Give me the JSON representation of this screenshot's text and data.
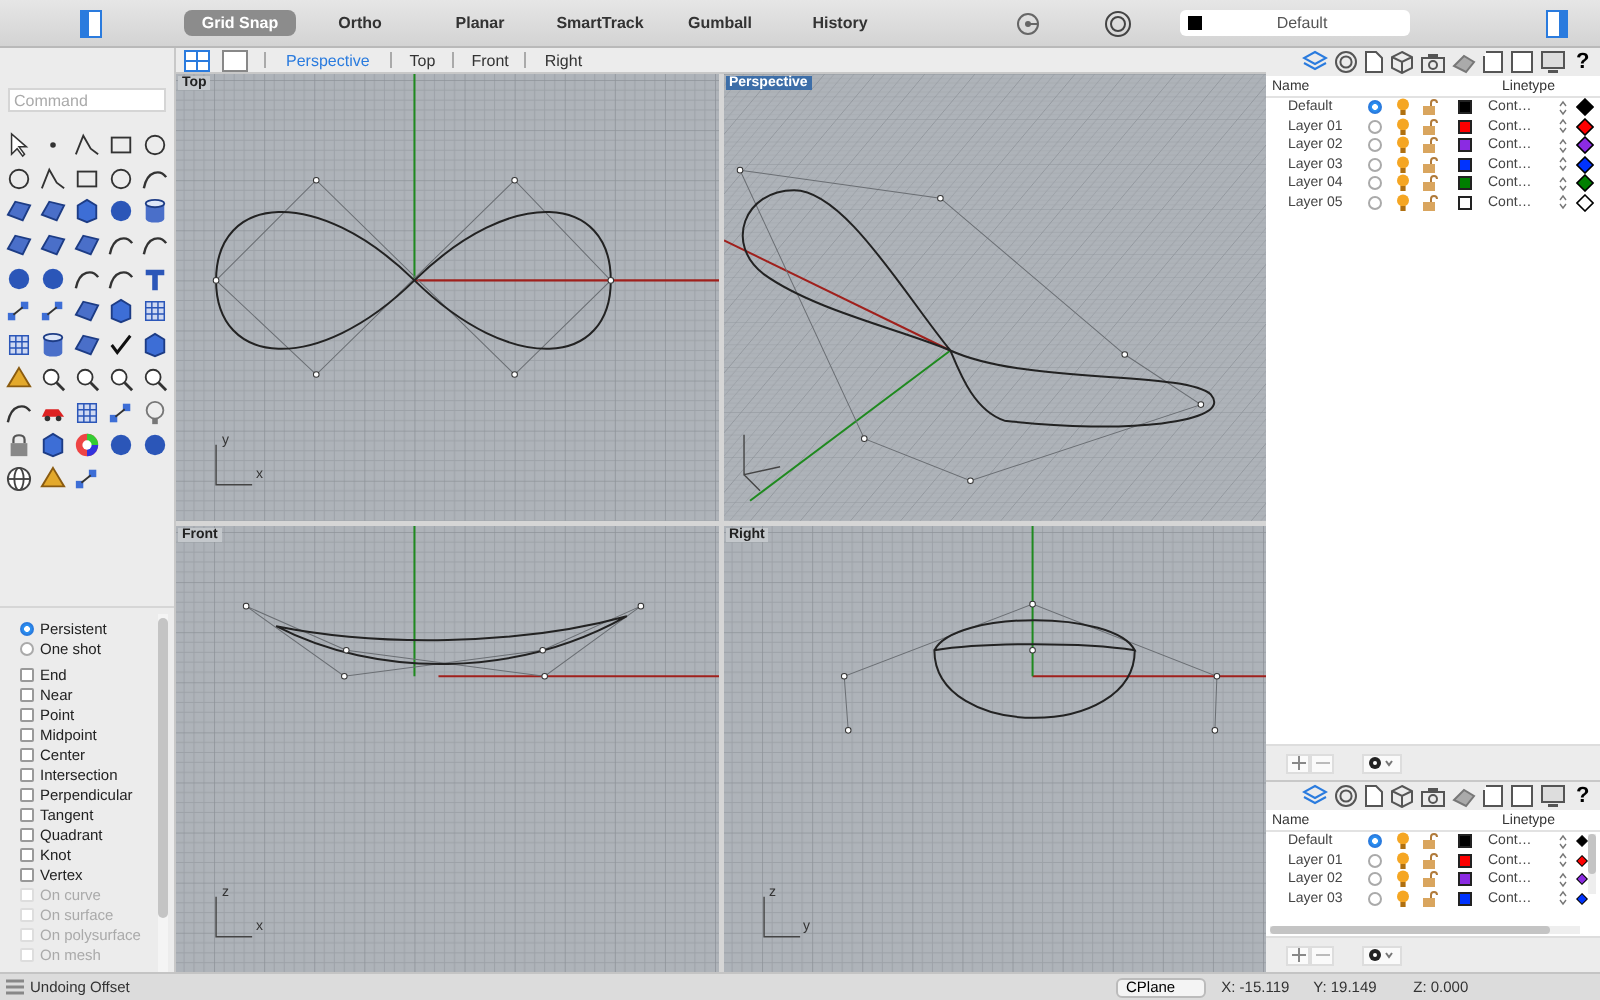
{
  "toolbar": {
    "modes": [
      {
        "label": "Grid Snap",
        "on": true
      },
      {
        "label": "Ortho",
        "on": false
      },
      {
        "label": "Planar",
        "on": false
      },
      {
        "label": "SmartTrack",
        "on": false
      },
      {
        "label": "Gumball",
        "on": false
      },
      {
        "label": "History",
        "on": false
      }
    ],
    "layer_field": {
      "color": "#000000",
      "value": "Default"
    }
  },
  "viewport_tabs": [
    {
      "label": "Perspective",
      "selected": true
    },
    {
      "label": "Top",
      "selected": false
    },
    {
      "label": "Front",
      "selected": false
    },
    {
      "label": "Right",
      "selected": false
    }
  ],
  "command": {
    "placeholder": "Command"
  },
  "osnap": {
    "modes": [
      {
        "label": "Persistent",
        "selected": true
      },
      {
        "label": "One shot",
        "selected": false
      }
    ],
    "snaps": [
      {
        "label": "End",
        "checked": false,
        "disabled": false
      },
      {
        "label": "Near",
        "checked": false,
        "disabled": false
      },
      {
        "label": "Point",
        "checked": false,
        "disabled": false
      },
      {
        "label": "Midpoint",
        "checked": false,
        "disabled": false
      },
      {
        "label": "Center",
        "checked": false,
        "disabled": false
      },
      {
        "label": "Intersection",
        "checked": false,
        "disabled": false
      },
      {
        "label": "Perpendicular",
        "checked": false,
        "disabled": false
      },
      {
        "label": "Tangent",
        "checked": false,
        "disabled": false
      },
      {
        "label": "Quadrant",
        "checked": false,
        "disabled": false
      },
      {
        "label": "Knot",
        "checked": false,
        "disabled": false
      },
      {
        "label": "Vertex",
        "checked": false,
        "disabled": false
      },
      {
        "label": "On curve",
        "checked": false,
        "disabled": true
      },
      {
        "label": "On surface",
        "checked": false,
        "disabled": true
      },
      {
        "label": "On polysurface",
        "checked": false,
        "disabled": true
      },
      {
        "label": "On mesh",
        "checked": false,
        "disabled": true
      }
    ]
  },
  "viewports": [
    {
      "title": "Top",
      "kind": "top",
      "active": false,
      "axis_labels": [
        "y",
        "x"
      ]
    },
    {
      "title": "Perspective",
      "kind": "perspective",
      "active": true
    },
    {
      "title": "Front",
      "kind": "front",
      "active": false,
      "axis_labels": [
        "z",
        "x"
      ]
    },
    {
      "title": "Right",
      "kind": "right",
      "active": false,
      "axis_labels": [
        "z",
        "y"
      ]
    }
  ],
  "layer_panels": [
    {
      "help": "?",
      "columns": [
        "Name",
        "Linetype"
      ],
      "layers": [
        {
          "name": "Default",
          "current": true,
          "color": "#000000",
          "linetype": "Cont…"
        },
        {
          "name": "Layer 01",
          "current": false,
          "color": "#ff0000",
          "linetype": "Cont…"
        },
        {
          "name": "Layer 02",
          "current": false,
          "color": "#8b2be2",
          "linetype": "Cont…"
        },
        {
          "name": "Layer 03",
          "current": false,
          "color": "#0033ff",
          "linetype": "Cont…"
        },
        {
          "name": "Layer 04",
          "current": false,
          "color": "#008000",
          "linetype": "Cont…"
        },
        {
          "name": "Layer 05",
          "current": false,
          "color": "#ffffff",
          "linetype": "Cont…"
        }
      ]
    },
    {
      "help": "?",
      "columns": [
        "Name",
        "Linetype"
      ],
      "layers": [
        {
          "name": "Default",
          "current": true,
          "color": "#000000",
          "linetype": "Cont…"
        },
        {
          "name": "Layer 01",
          "current": false,
          "color": "#ff0000",
          "linetype": "Cont…"
        },
        {
          "name": "Layer 02",
          "current": false,
          "color": "#8b2be2",
          "linetype": "Cont…"
        },
        {
          "name": "Layer 03",
          "current": false,
          "color": "#0033ff",
          "linetype": "Cont…"
        }
      ]
    }
  ],
  "status_bar": {
    "message": "Undoing Offset",
    "cplane": "CPlane",
    "x": "X: -15.119",
    "y": "Y: 19.149",
    "z": "Z: 0.000"
  }
}
